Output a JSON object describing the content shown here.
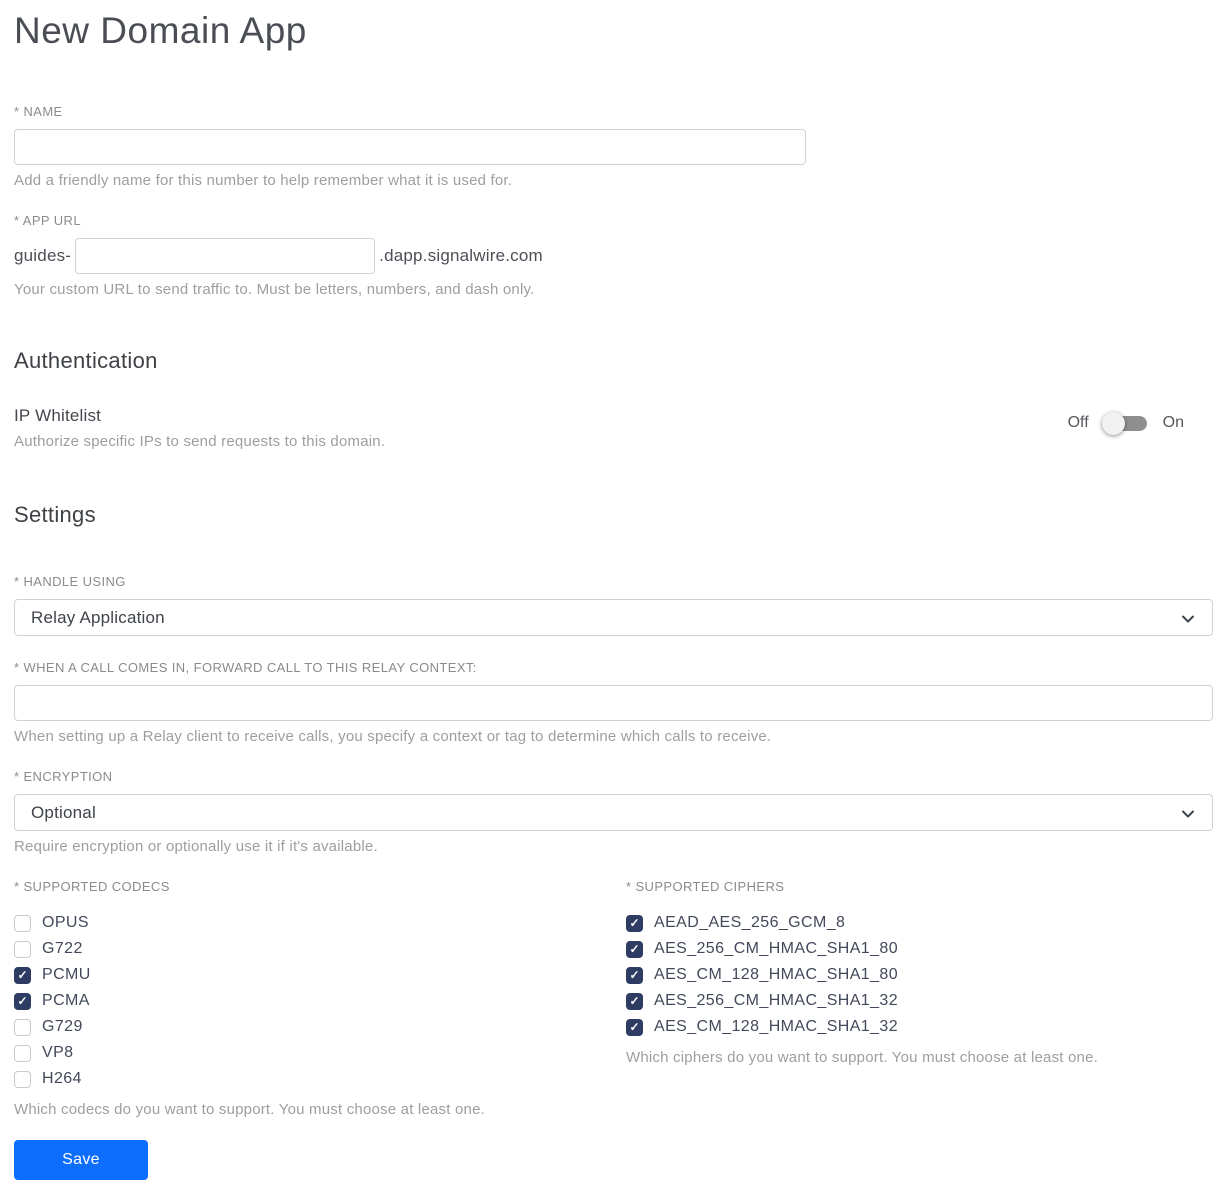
{
  "page": {
    "title": "New Domain App"
  },
  "name_field": {
    "label": "* NAME",
    "value": "",
    "helper": "Add a friendly name for this number to help remember what it is used for."
  },
  "app_url_field": {
    "label": "* APP URL",
    "prefix": "guides-",
    "value": "",
    "suffix": ".dapp.signalwire.com",
    "helper": "Your custom URL to send traffic to. Must be letters, numbers, and dash only."
  },
  "authentication": {
    "heading": "Authentication",
    "ip_whitelist": {
      "label": "IP Whitelist",
      "description": "Authorize specific IPs to send requests to this domain.",
      "off_label": "Off",
      "on_label": "On",
      "state": "off"
    }
  },
  "settings": {
    "heading": "Settings",
    "handle_using": {
      "label": "* HANDLE USING",
      "selected": "Relay Application"
    },
    "relay_context": {
      "label": "* WHEN A CALL COMES IN, FORWARD CALL TO THIS RELAY CONTEXT:",
      "value": "",
      "helper": "When setting up a Relay client to receive calls, you specify a context or tag to determine which calls to receive."
    },
    "encryption": {
      "label": "* ENCRYPTION",
      "selected": "Optional",
      "helper": "Require encryption or optionally use it if it's available."
    },
    "codecs": {
      "label": "* SUPPORTED CODECS",
      "options": [
        {
          "label": "OPUS",
          "checked": false
        },
        {
          "label": "G722",
          "checked": false
        },
        {
          "label": "PCMU",
          "checked": true
        },
        {
          "label": "PCMA",
          "checked": true
        },
        {
          "label": "G729",
          "checked": false
        },
        {
          "label": "VP8",
          "checked": false
        },
        {
          "label": "H264",
          "checked": false
        }
      ],
      "helper": "Which codecs do you want to support. You must choose at least one."
    },
    "ciphers": {
      "label": "* SUPPORTED CIPHERS",
      "options": [
        {
          "label": "AEAD_AES_256_GCM_8",
          "checked": true
        },
        {
          "label": "AES_256_CM_HMAC_SHA1_80",
          "checked": true
        },
        {
          "label": "AES_CM_128_HMAC_SHA1_80",
          "checked": true
        },
        {
          "label": "AES_256_CM_HMAC_SHA1_32",
          "checked": true
        },
        {
          "label": "AES_CM_128_HMAC_SHA1_32",
          "checked": true
        }
      ],
      "helper": "Which ciphers do you want to support. You must choose at least one."
    }
  },
  "save_button": {
    "label": "Save"
  },
  "colors": {
    "accent_blue": "#0d6efd",
    "checkbox_checked": "#2e3c64",
    "toggle_track": "#8f8f8f",
    "input_border": "#ced3da"
  }
}
